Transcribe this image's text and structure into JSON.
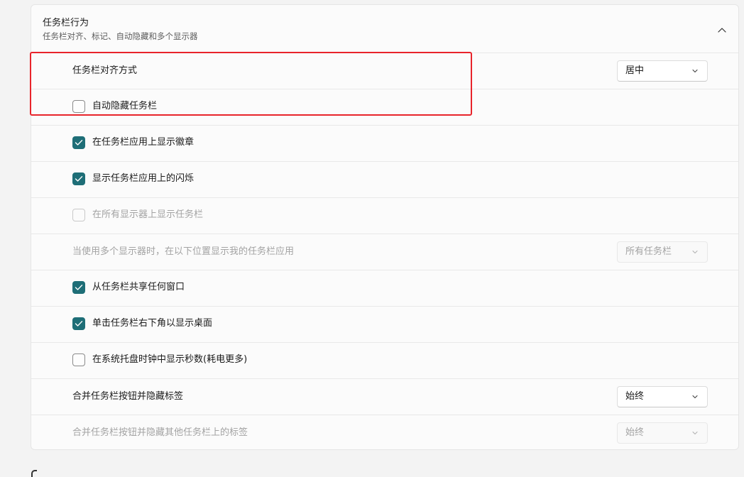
{
  "section": {
    "title": "任务栏行为",
    "subtitle": "任务栏对齐、标记、自动隐藏和多个显示器",
    "collapse_icon": "chevron-up-icon"
  },
  "rows": [
    {
      "type": "dropdown",
      "label": "任务栏对齐方式",
      "value": "居中",
      "enabled": true
    },
    {
      "type": "checkbox",
      "label": "自动隐藏任务栏",
      "checked": false,
      "enabled": true
    },
    {
      "type": "checkbox",
      "label": "在任务栏应用上显示徽章",
      "checked": true,
      "enabled": true
    },
    {
      "type": "checkbox",
      "label": "显示任务栏应用上的闪烁",
      "checked": true,
      "enabled": true
    },
    {
      "type": "checkbox",
      "label": "在所有显示器上显示任务栏",
      "checked": false,
      "enabled": false
    },
    {
      "type": "dropdown",
      "label": "当使用多个显示器时，在以下位置显示我的任务栏应用",
      "value": "所有任务栏",
      "enabled": false
    },
    {
      "type": "checkbox",
      "label": "从任务栏共享任何窗口",
      "checked": true,
      "enabled": true
    },
    {
      "type": "checkbox",
      "label": "单击任务栏右下角以显示桌面",
      "checked": true,
      "enabled": true
    },
    {
      "type": "checkbox",
      "label": "在系统托盘时钟中显示秒数(耗电更多)",
      "checked": false,
      "enabled": true
    },
    {
      "type": "dropdown",
      "label": "合并任务栏按钮并隐藏标签",
      "value": "始终",
      "enabled": true
    },
    {
      "type": "dropdown",
      "label": "合并任务栏按钮并隐藏其他任务栏上的标签",
      "value": "始终",
      "enabled": false
    }
  ],
  "colors": {
    "accent": "#1e6e77",
    "highlight": "#e8242b"
  }
}
